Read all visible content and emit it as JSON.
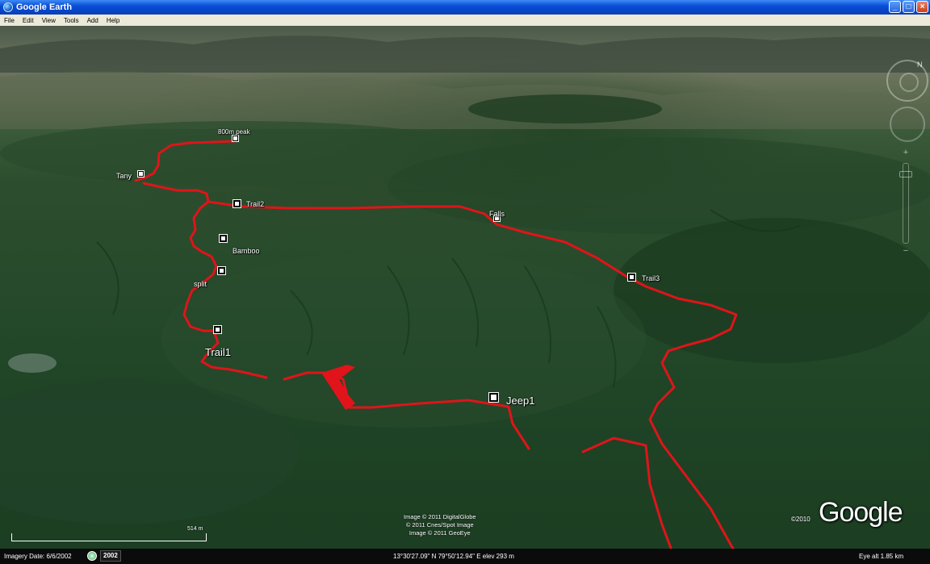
{
  "window": {
    "title": "Google Earth",
    "buttons": {
      "minimize": "_",
      "maximize": "□",
      "close": "×"
    }
  },
  "menu": [
    "File",
    "Edit",
    "View",
    "Tools",
    "Add",
    "Help"
  ],
  "places": {
    "peak": "800m peak",
    "tany": "Tany",
    "trail2": "Trail2",
    "falls": "Falls",
    "bamboo": "Bamboo",
    "split": "split",
    "trail3": "Trail3",
    "trail1": "Trail1",
    "jeep1": "Jeep1"
  },
  "credits": {
    "line1": "Image © 2011 DigitalGlobe",
    "line2": "© 2011 Cnes/Spot Image",
    "line3": "Image © 2011 GeoEye",
    "copyright": "©2010",
    "logo": "Google"
  },
  "scale": {
    "label": "514 m"
  },
  "navigation": {
    "north": "N",
    "zoom_in": "+",
    "zoom_out": "−"
  },
  "status": {
    "imagery_date": "Imagery Date: 6/6/2002",
    "year": "2002",
    "coords": "13°30'27.09\" N  79°50'12.94\" E  elev  293 m",
    "eye_alt": "Eye alt    1.85 km"
  },
  "colors": {
    "track": "#e0141a",
    "titlebar": "#0a4ed8",
    "menubar": "#ece9d8"
  }
}
